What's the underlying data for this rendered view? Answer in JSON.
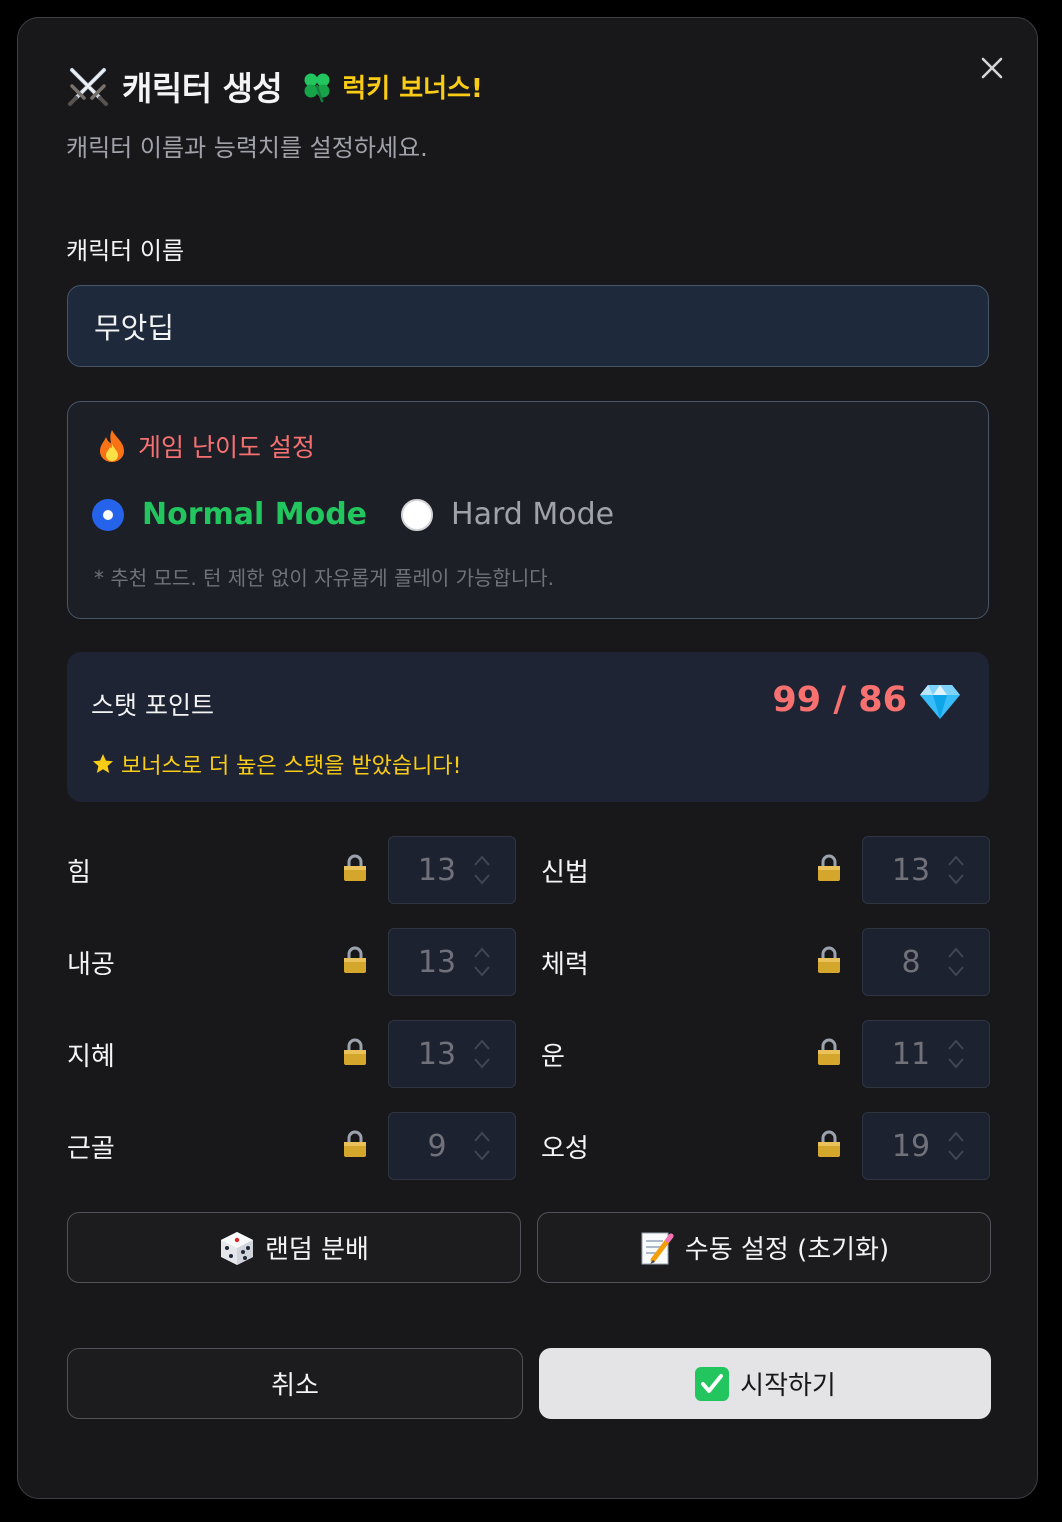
{
  "modal": {
    "title": "캐릭터 생성",
    "title_icon": "crossed-swords-icon",
    "lucky_badge": "럭키 보너스!",
    "lucky_icon": "clover-icon",
    "subtitle": "캐릭터 이름과 능력치를 설정하세요.",
    "close_icon": "close-icon"
  },
  "name_field": {
    "label": "캐릭터 이름",
    "value": "무앗딥"
  },
  "difficulty": {
    "title": "게임 난이도 설정",
    "icon": "fire-icon",
    "modes": [
      {
        "label": "Normal Mode",
        "selected": true
      },
      {
        "label": "Hard Mode",
        "selected": false
      }
    ],
    "hint": "* 추천 모드. 턴 제한 없이 자유롭게 플레이 가능합니다."
  },
  "stat_points": {
    "title": "스탯 포인트",
    "value": "99 / 86",
    "icon": "gem-icon",
    "bonus_text": "보너스로 더 높은 스탯을 받았습니다!",
    "bonus_icon": "star-icon"
  },
  "stats": [
    {
      "label": "힘",
      "value": "13"
    },
    {
      "label": "신법",
      "value": "13"
    },
    {
      "label": "내공",
      "value": "13"
    },
    {
      "label": "체력",
      "value": "8"
    },
    {
      "label": "지혜",
      "value": "13"
    },
    {
      "label": "운",
      "value": "11"
    },
    {
      "label": "근골",
      "value": "9"
    },
    {
      "label": "오성",
      "value": "19"
    }
  ],
  "actions": {
    "random_label": "랜덤 분배",
    "manual_label": "수동 설정 (초기화)",
    "cancel_label": "취소",
    "start_label": "시작하기"
  },
  "colors": {
    "accent_blue": "#2563eb",
    "normal_green": "#22c55e",
    "warning_red": "#f87171",
    "bonus_yellow": "#facc15"
  }
}
